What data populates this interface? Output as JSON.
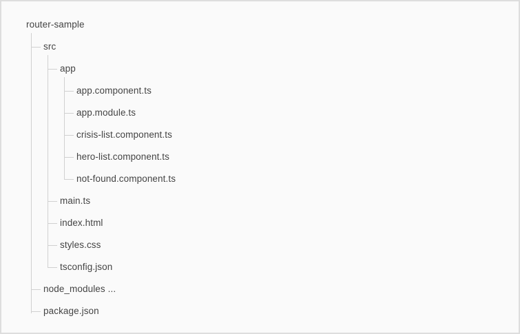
{
  "tree": {
    "root": "router-sample",
    "src": "src",
    "app": "app",
    "app_component": "app.component.ts",
    "app_module": "app.module.ts",
    "crisis_list": "crisis-list.component.ts",
    "hero_list": "hero-list.component.ts",
    "not_found": "not-found.component.ts",
    "main_ts": "main.ts",
    "index_html": "index.html",
    "styles_css": "styles.css",
    "tsconfig": "tsconfig.json",
    "node_modules": "node_modules ...",
    "package_json": "package.json"
  }
}
